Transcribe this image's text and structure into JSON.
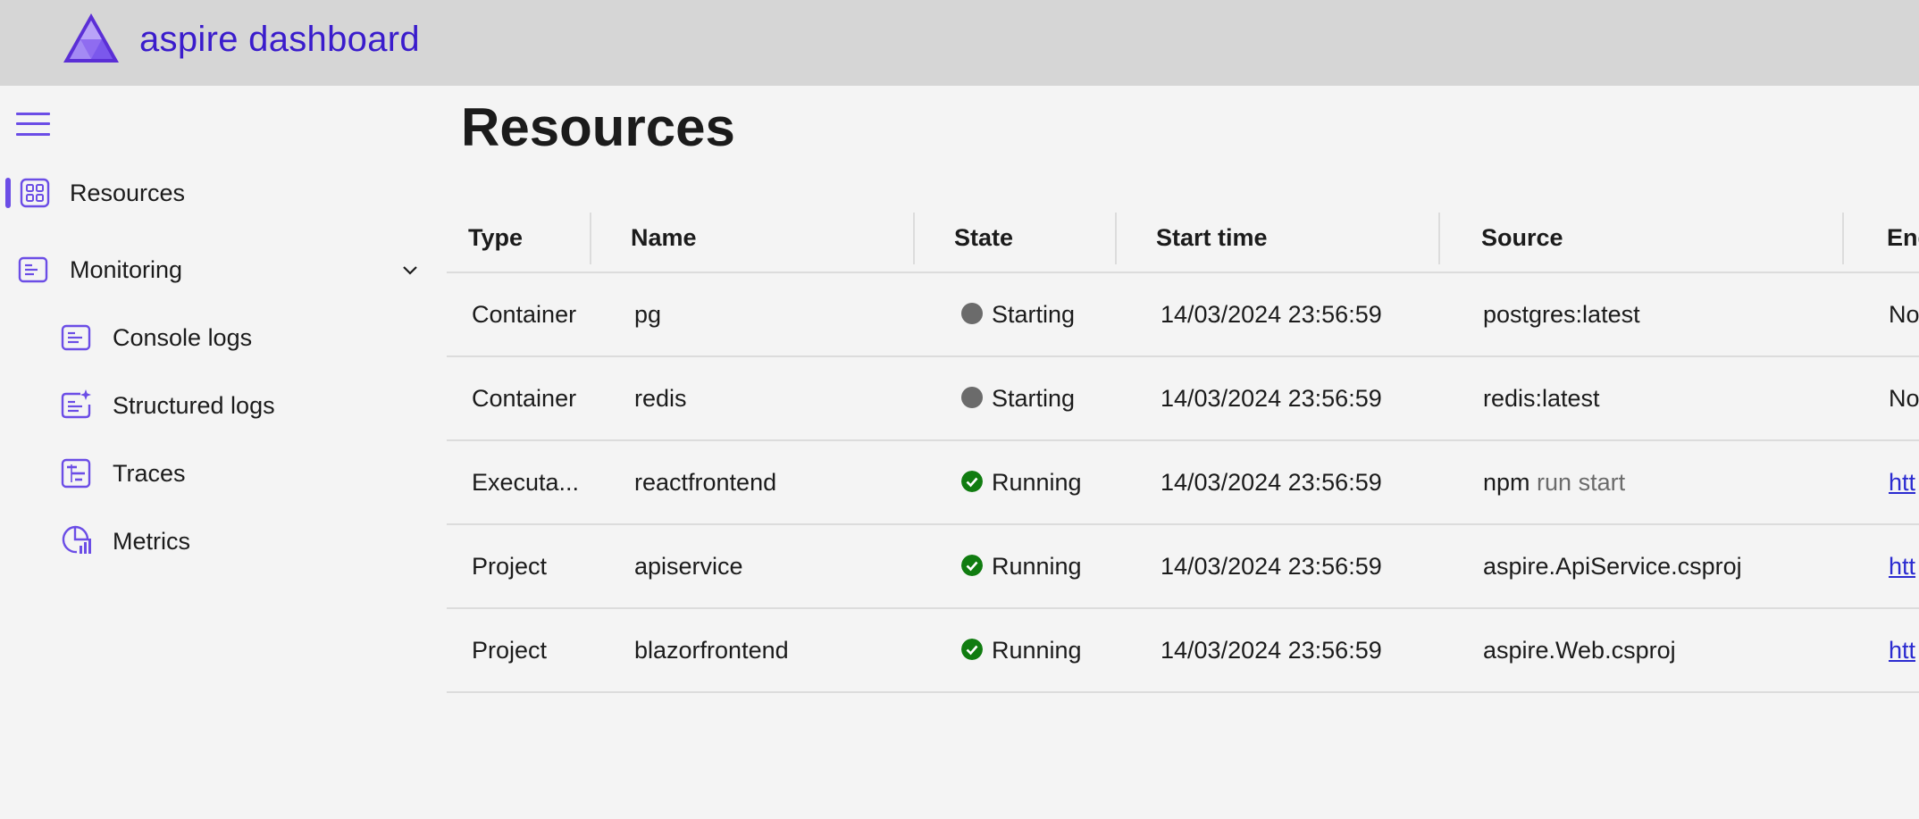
{
  "app": {
    "title": "aspire dashboard"
  },
  "sidebar": {
    "items": [
      {
        "label": "Resources",
        "icon": "resources-grid-icon",
        "active": true
      },
      {
        "label": "Monitoring",
        "icon": "monitoring-icon",
        "expanded": true
      },
      {
        "label": "Console logs",
        "icon": "console-logs-icon"
      },
      {
        "label": "Structured logs",
        "icon": "structured-logs-icon"
      },
      {
        "label": "Traces",
        "icon": "traces-icon"
      },
      {
        "label": "Metrics",
        "icon": "metrics-icon"
      }
    ]
  },
  "main": {
    "title": "Resources",
    "table": {
      "columns": [
        "Type",
        "Name",
        "State",
        "Start time",
        "Source",
        "End"
      ],
      "rows": [
        {
          "type": "Container",
          "name": "pg",
          "state": "Starting",
          "start_time": "14/03/2024 23:56:59",
          "source": "postgres:latest",
          "source_args": "",
          "endpoint": "No"
        },
        {
          "type": "Container",
          "name": "redis",
          "state": "Starting",
          "start_time": "14/03/2024 23:56:59",
          "source": "redis:latest",
          "source_args": "",
          "endpoint": "No"
        },
        {
          "type": "Executa...",
          "name": "reactfrontend",
          "state": "Running",
          "start_time": "14/03/2024 23:56:59",
          "source": "npm",
          "source_args": "run start",
          "endpoint": "htt"
        },
        {
          "type": "Project",
          "name": "apiservice",
          "state": "Running",
          "start_time": "14/03/2024 23:56:59",
          "source": "aspire.ApiService.csproj",
          "source_args": "",
          "endpoint": "htt"
        },
        {
          "type": "Project",
          "name": "blazorfrontend",
          "state": "Running",
          "start_time": "14/03/2024 23:56:59",
          "source": "aspire.Web.csproj",
          "source_args": "",
          "endpoint": "htt"
        }
      ]
    }
  },
  "colors": {
    "accent": "#6b4de6",
    "title": "#3a1ccc",
    "starting": "#6b6b6b",
    "running": "#107c10"
  }
}
